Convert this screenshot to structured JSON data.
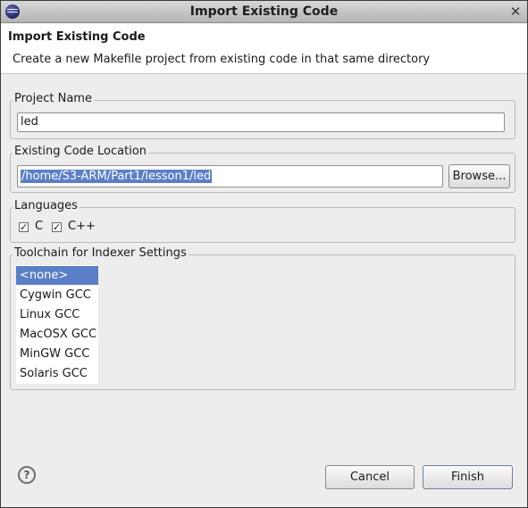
{
  "window": {
    "title": "Import Existing Code"
  },
  "header": {
    "title": "Import Existing Code",
    "description": "Create a new Makefile project from existing code in that same directory"
  },
  "project_name": {
    "label": "Project Name",
    "value": "led"
  },
  "code_location": {
    "label": "Existing Code Location",
    "value": "/home/S3-ARM/Part1/lesson1/led",
    "browse_label": "Browse..."
  },
  "languages": {
    "label": "Languages",
    "items": [
      {
        "label": "C",
        "checked": true,
        "mark": "✓"
      },
      {
        "label": "C++",
        "checked": true,
        "mark": "✓"
      }
    ]
  },
  "toolchain": {
    "label": "Toolchain for Indexer Settings",
    "selected": "<none>",
    "items": [
      "<none>",
      "Cygwin GCC",
      "Linux GCC",
      "MacOSX GCC",
      "MinGW GCC",
      "Solaris GCC"
    ]
  },
  "footer": {
    "help_glyph": "?",
    "cancel_label": "Cancel",
    "finish_label": "Finish"
  },
  "icons": {
    "app": "eclipse-icon",
    "close": "close-icon",
    "help": "help-icon"
  }
}
